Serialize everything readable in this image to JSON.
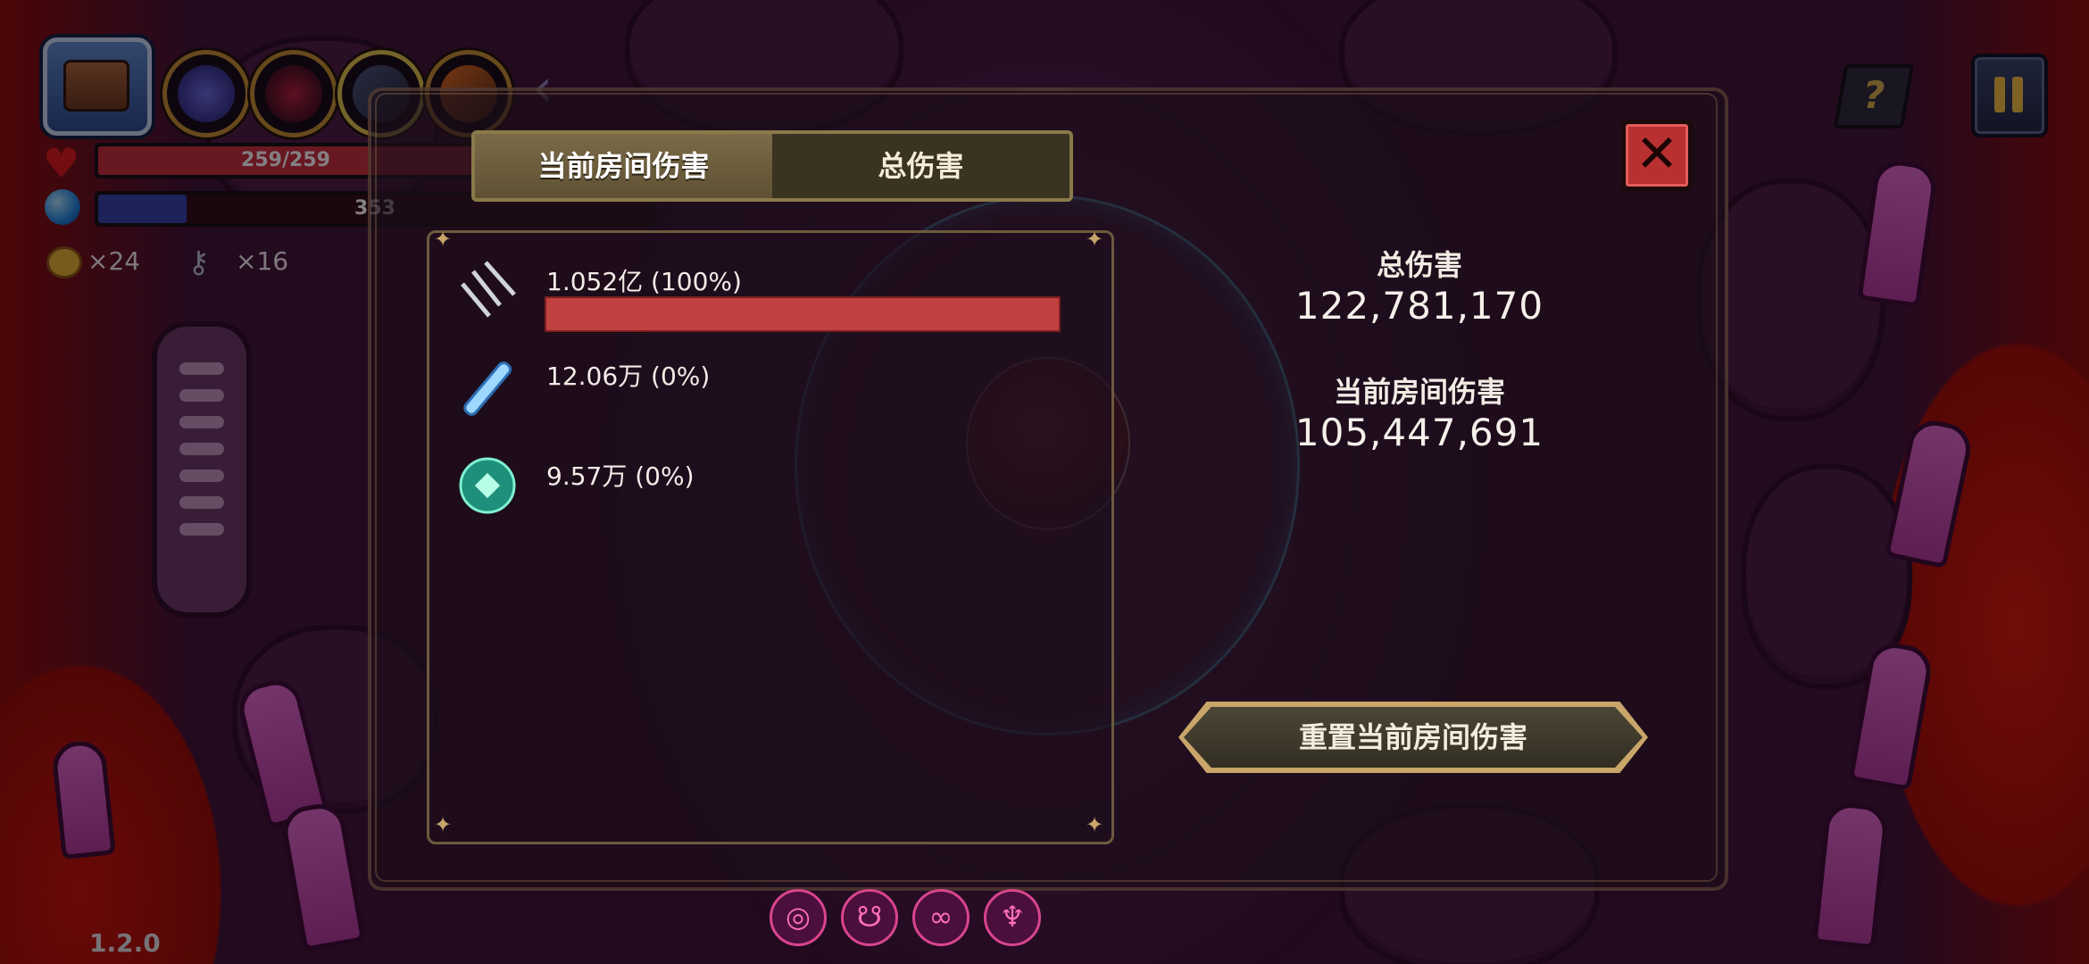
{
  "hud": {
    "hp_text": "259/259",
    "hp_fraction": 1.0,
    "mana_text": "353",
    "mana_fraction": 0.16,
    "coins": "×24",
    "keys": "×16",
    "version": "1.2.0"
  },
  "panel": {
    "tabs": [
      "当前房间伤害",
      "总伤害"
    ],
    "active_tab": 0,
    "close_icon": "close-icon",
    "rows": [
      {
        "icon": "triple-blade-icon",
        "label": "1.052亿 (100%)",
        "share": 1.0
      },
      {
        "icon": "ice-shard-icon",
        "label": "12.06万 (0%)",
        "share": 0.0
      },
      {
        "icon": "green-orb-icon",
        "label": "9.57万 (0%)",
        "share": 0.0
      }
    ],
    "stats": {
      "total_label": "总伤害",
      "total_value": "122,781,170",
      "room_label": "当前房间伤害",
      "room_value": "105,447,691"
    },
    "reset_label": "重置当前房间伤害"
  },
  "colors": {
    "damage_bar": "#c0413f",
    "hp_bar": "#c9303a",
    "mana_bar": "#3344a8",
    "accent_gold": "#c49330"
  }
}
